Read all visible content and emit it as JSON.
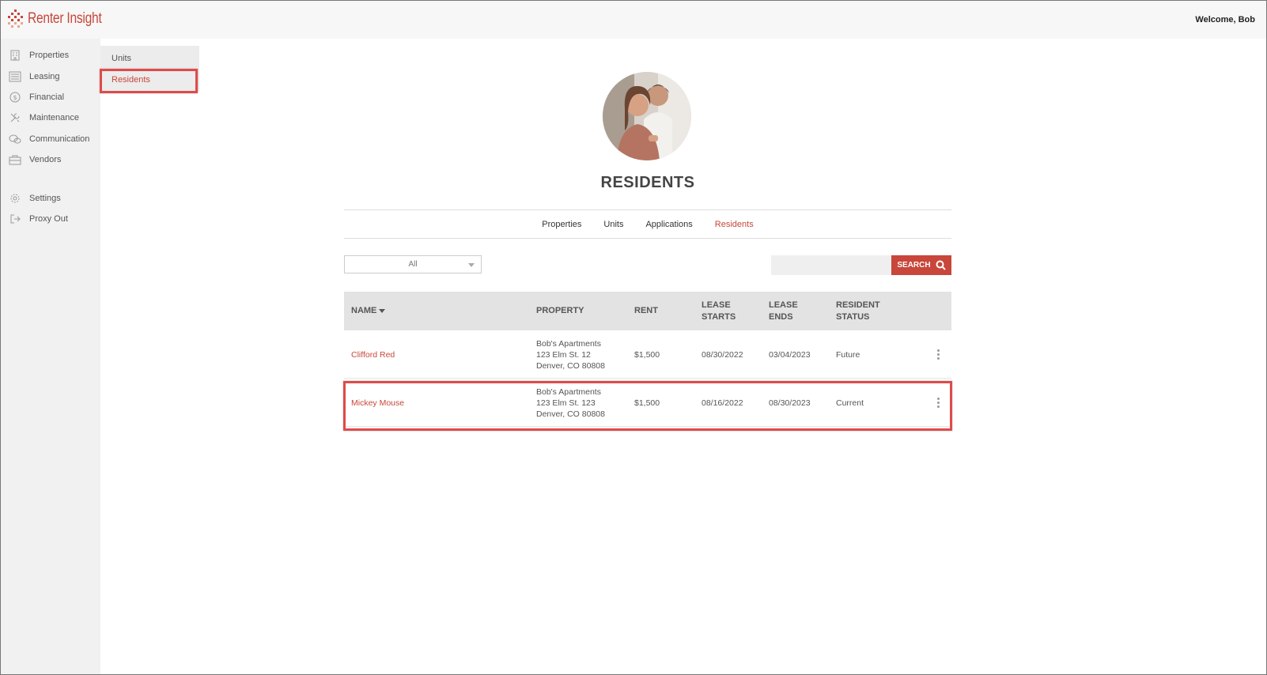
{
  "app": {
    "name": "Renter Insight",
    "welcome": "Welcome, Bob"
  },
  "sidebar": {
    "items": [
      {
        "label": "Properties",
        "icon": "building-icon"
      },
      {
        "label": "Leasing",
        "icon": "list-icon"
      },
      {
        "label": "Financial",
        "icon": "dollar-icon"
      },
      {
        "label": "Maintenance",
        "icon": "tools-icon"
      },
      {
        "label": "Communication",
        "icon": "chat-icon"
      },
      {
        "label": "Vendors",
        "icon": "briefcase-icon"
      },
      {
        "label": "Settings",
        "icon": "gear-icon"
      },
      {
        "label": "Proxy Out",
        "icon": "logout-icon"
      }
    ]
  },
  "subnav": {
    "items": [
      "Units",
      "Residents"
    ],
    "active": "Residents"
  },
  "main": {
    "title": "RESIDENTS",
    "tabs": [
      "Properties",
      "Units",
      "Applications",
      "Residents"
    ],
    "active_tab": "Residents",
    "filter": {
      "value": "All"
    },
    "search": {
      "button_label": "SEARCH",
      "value": ""
    }
  },
  "table": {
    "headers": {
      "name": "NAME",
      "property": "PROPERTY",
      "rent": "RENT",
      "lease_starts_1": "LEASE",
      "lease_starts_2": "STARTS",
      "lease_ends_1": "LEASE",
      "lease_ends_2": "ENDS",
      "status_1": "RESIDENT",
      "status_2": "STATUS"
    },
    "rows": [
      {
        "name": "Clifford Red",
        "property_line1": "Bob's Apartments",
        "property_line2": "123 Elm St. 12",
        "property_line3": "Denver, CO 80808",
        "rent": "$1,500",
        "lease_starts": "08/30/2022",
        "lease_ends": "03/04/2023",
        "status": "Future"
      },
      {
        "name": "Mickey Mouse",
        "property_line1": "Bob's Apartments",
        "property_line2": "123 Elm St. 123",
        "property_line3": "Denver, CO 80808",
        "rent": "$1,500",
        "lease_starts": "08/16/2022",
        "lease_ends": "08/30/2023",
        "status": "Current"
      }
    ]
  },
  "colors": {
    "accent": "#c8463a",
    "highlight": "#e04a4a"
  }
}
